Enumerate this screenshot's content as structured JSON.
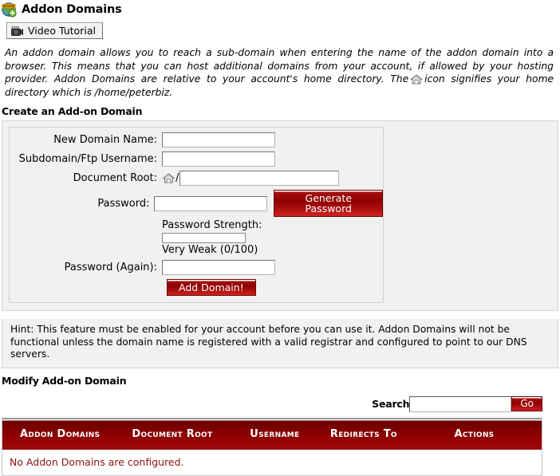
{
  "header": {
    "icon": "globe-www-add-icon",
    "title": "Addon Domains"
  },
  "tutorial": {
    "icon": "video-camera-icon",
    "label": "Video Tutorial"
  },
  "intro": {
    "text_before_icon": "An addon domain allows you to reach a sub-domain when entering the name of the addon domain into a browser. This means that you can host additional domains from your account, if allowed by your hosting provider. Addon Domains are relative to your account's home directory. The",
    "icon": "home-directory-icon",
    "text_after_icon": "icon signifies your home directory which is /home/peterbiz."
  },
  "create_section": {
    "title": "Create an Add-on Domain",
    "fields": [
      {
        "label": "New Domain Name:",
        "value": "",
        "placeholder": ""
      },
      {
        "label": "Subdomain/Ftp Username:",
        "value": "",
        "placeholder": ""
      },
      {
        "label": "Document Root:",
        "value": "",
        "placeholder": "",
        "prefix_icon": "home-directory-icon",
        "prefix_text": "/"
      },
      {
        "label": "Password:",
        "value": "",
        "placeholder": ""
      },
      {
        "label": "Password (Again):",
        "value": "",
        "placeholder": ""
      }
    ],
    "generate_password_label": "Generate Password",
    "strength": {
      "label": "Password Strength:",
      "percent": 0,
      "text": "Very Weak (0/100)"
    },
    "add_domain_label": "Add Domain!"
  },
  "hint": {
    "text": "Hint: This feature must be enabled for your account before you can use it. Addon Domains will not be functional unless the domain name is registered with a valid registrar and configured to point to our DNS servers."
  },
  "modify_section": {
    "title": "Modify Add-on Domain",
    "search_label": "Search",
    "search_value": "",
    "search_placeholder": "",
    "go_label": "Go",
    "columns": [
      "Addon Domains",
      "Document Root",
      "Username",
      "Redirects To",
      "Actions"
    ],
    "rows": [],
    "empty_message": "No Addon Domains are configured."
  },
  "colors": {
    "accent_red": "#8f0000",
    "button_red": "#a00a0a",
    "empty_text_red": "#8e1212",
    "panel_bg": "#f1f1f1",
    "panel_border": "#cbdbc8"
  }
}
